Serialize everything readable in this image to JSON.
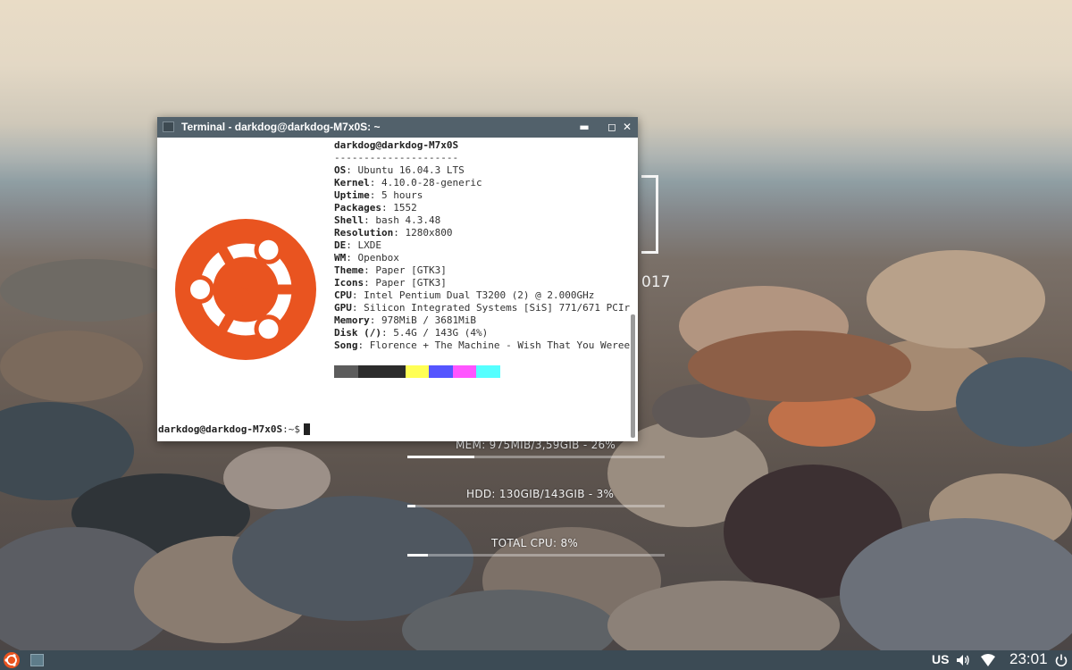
{
  "desktop": {
    "conky": {
      "year": "017",
      "mem": "MEM: 975MIB/3,59GIB  - 26%",
      "mem_percent": 26,
      "hdd": "HDD: 130GIB/143GIB  - 3%",
      "hdd_percent": 3,
      "cpu": "TOTAL CPU: 8%",
      "cpu_percent": 8
    }
  },
  "terminal": {
    "title": "Terminal - darkdog@darkdog-M7x0S: ~",
    "controls": {
      "minimize": "▬",
      "maximize": "◻",
      "close": "✕"
    },
    "header": "darkdog@darkdog-M7x0S",
    "separator": "---------------------",
    "info": [
      {
        "key": "OS",
        "value": "Ubuntu 16.04.3 LTS"
      },
      {
        "key": "Kernel",
        "value": "4.10.0-28-generic"
      },
      {
        "key": "Uptime",
        "value": "5 hours"
      },
      {
        "key": "Packages",
        "value": "1552"
      },
      {
        "key": "Shell",
        "value": "bash 4.3.48"
      },
      {
        "key": "Resolution",
        "value": "1280x800"
      },
      {
        "key": "DE",
        "value": "LXDE"
      },
      {
        "key": "WM",
        "value": "Openbox"
      },
      {
        "key": "Theme",
        "value": "Paper [GTK3]"
      },
      {
        "key": "Icons",
        "value": "Paper [GTK3]"
      },
      {
        "key": "CPU",
        "value": "Intel Pentium Dual T3200 (2) @ 2.000GHz"
      },
      {
        "key": "GPU",
        "value": "Silicon Integrated Systems [SiS] 771/671 PCIr"
      },
      {
        "key": "Memory",
        "value": "978MiB / 3681MiB"
      },
      {
        "key": "Disk (/)",
        "value": "5.4G / 143G (4%)"
      },
      {
        "key": "Song",
        "value": "Florence + The Machine - Wish That You Weree"
      }
    ],
    "swatches": [
      "#5c5c5c",
      "#2c2c2c",
      "#2c2c2c",
      "#ffff55",
      "#5555ff",
      "#ff55ff",
      "#55ffff"
    ],
    "prompt_user": "darkdog@darkdog-M7x0S",
    "prompt_path": ":~$",
    "logo_color": "#e95420"
  },
  "taskbar": {
    "keyboard_layout": "US",
    "clock": "23:01",
    "icons": [
      "ubuntu-menu-icon",
      "terminal-task-icon",
      "volume-icon",
      "wifi-icon",
      "power-icon"
    ]
  }
}
